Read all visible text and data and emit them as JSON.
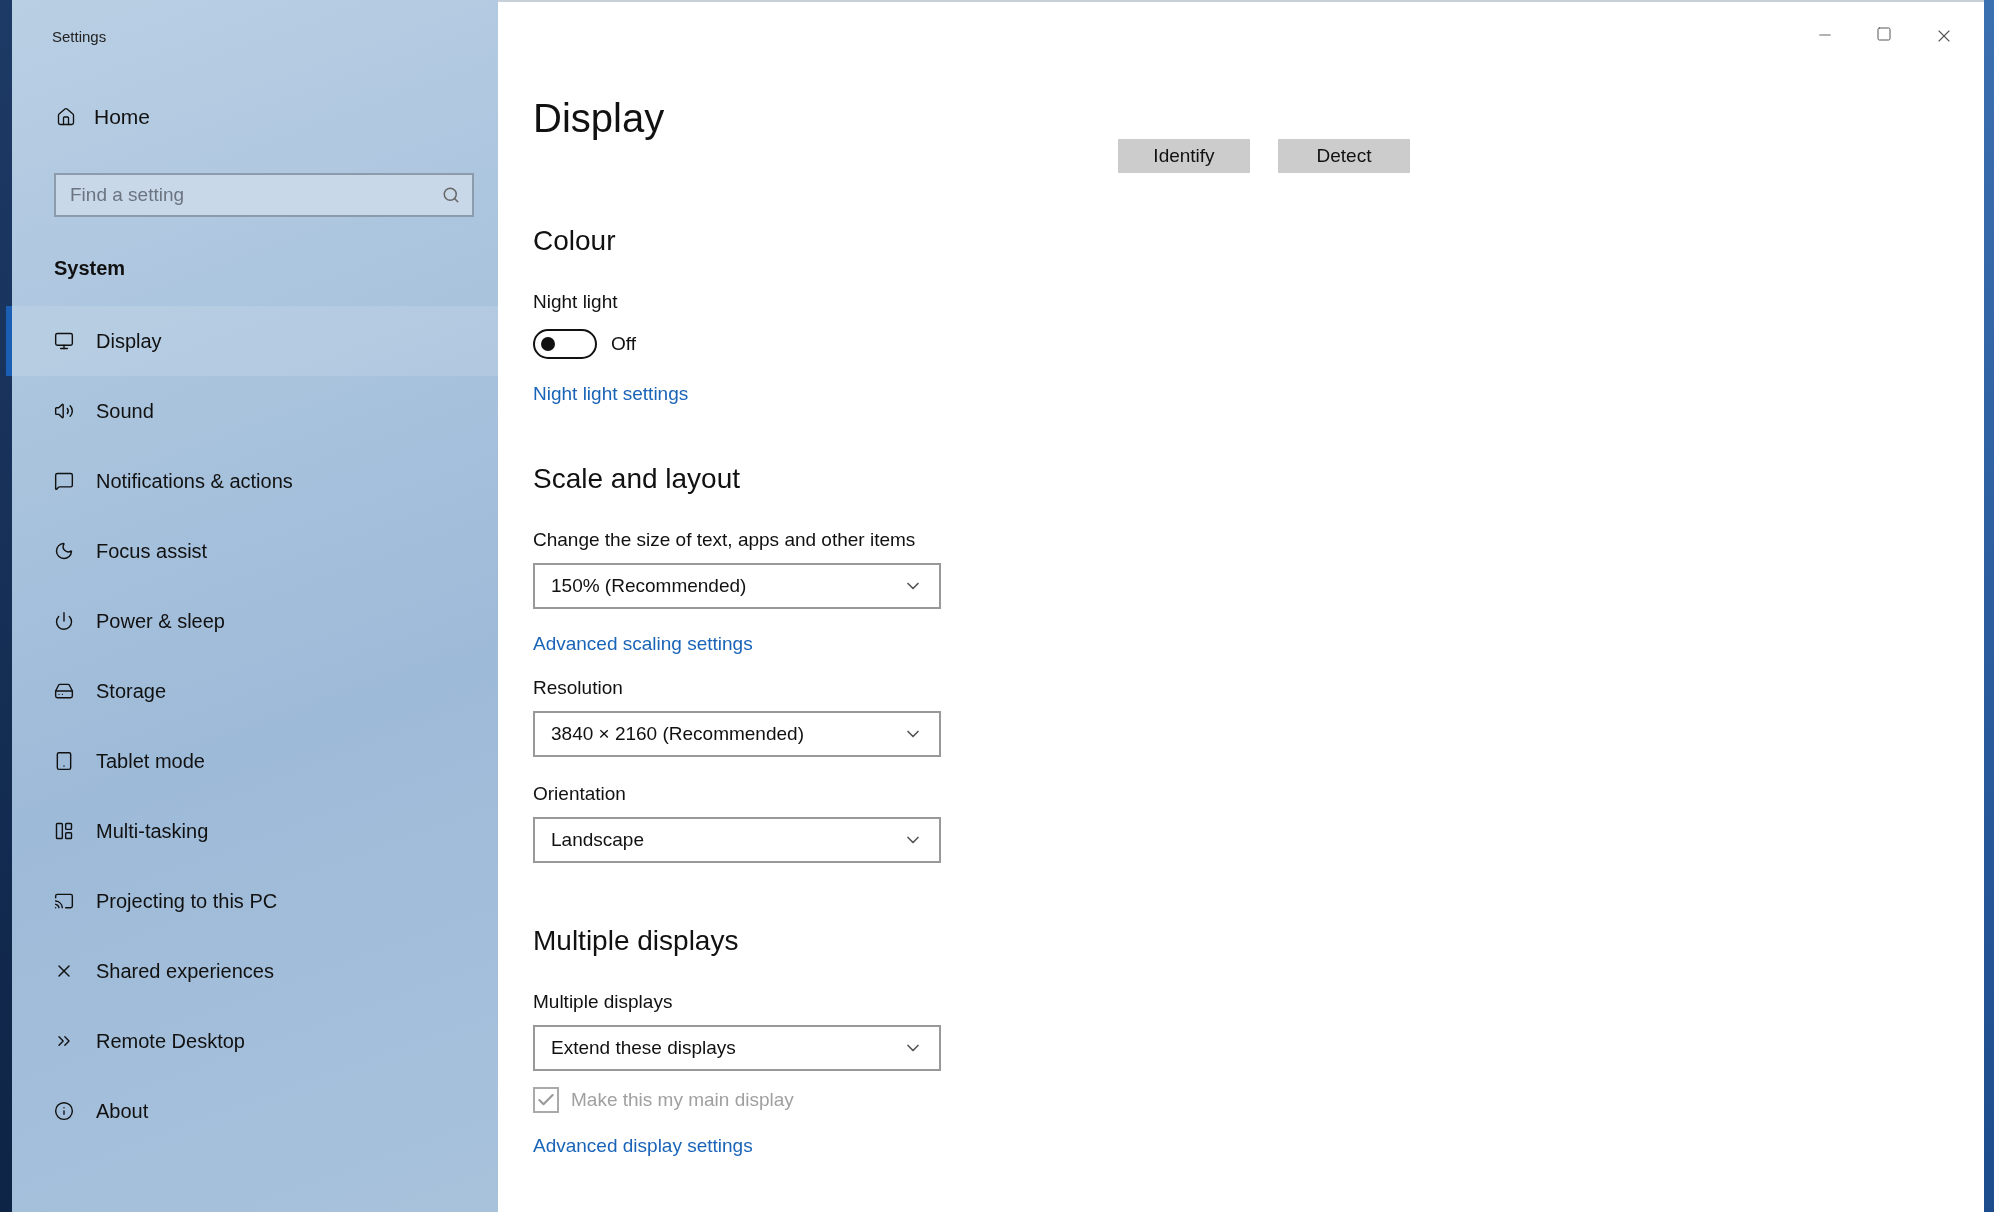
{
  "window": {
    "title": "Settings"
  },
  "sidebar": {
    "home": "Home",
    "search": {
      "placeholder": "Find a setting"
    },
    "section": "System",
    "items": [
      {
        "label": "Display",
        "selected": true
      },
      {
        "label": "Sound",
        "selected": false
      },
      {
        "label": "Notifications & actions",
        "selected": false
      },
      {
        "label": "Focus assist",
        "selected": false
      },
      {
        "label": "Power & sleep",
        "selected": false
      },
      {
        "label": "Storage",
        "selected": false
      },
      {
        "label": "Tablet mode",
        "selected": false
      },
      {
        "label": "Multi-tasking",
        "selected": false
      },
      {
        "label": "Projecting to this PC",
        "selected": false
      },
      {
        "label": "Shared experiences",
        "selected": false
      },
      {
        "label": "Remote Desktop",
        "selected": false
      },
      {
        "label": "About",
        "selected": false
      }
    ]
  },
  "content": {
    "title": "Display",
    "buttons": [
      "Identify",
      "Detect"
    ],
    "sections": [
      {
        "heading": "Colour",
        "items": [
          {
            "kind": "label",
            "text": "Night light"
          },
          {
            "kind": "toggle",
            "on": false,
            "text": "Off"
          },
          {
            "kind": "link",
            "text": "Night light settings"
          }
        ]
      },
      {
        "heading": "Scale and layout",
        "items": [
          {
            "kind": "label",
            "text": "Change the size of text, apps and other items"
          },
          {
            "kind": "dropdown",
            "text": "150% (Recommended)"
          },
          {
            "kind": "link",
            "text": "Advanced scaling settings"
          },
          {
            "kind": "label",
            "text": "Resolution"
          },
          {
            "kind": "dropdown",
            "text": "3840 × 2160 (Recommended)"
          },
          {
            "kind": "label",
            "text": "Orientation"
          },
          {
            "kind": "dropdown",
            "text": "Landscape"
          }
        ]
      },
      {
        "heading": "Multiple displays",
        "items": [
          {
            "kind": "label",
            "text": "Multiple displays"
          },
          {
            "kind": "dropdown",
            "text": "Extend these displays"
          },
          {
            "kind": "checkbox",
            "checked": true,
            "disabled": true,
            "text": "Make this my main display"
          },
          {
            "kind": "link",
            "text": "Advanced display settings"
          }
        ]
      }
    ]
  }
}
